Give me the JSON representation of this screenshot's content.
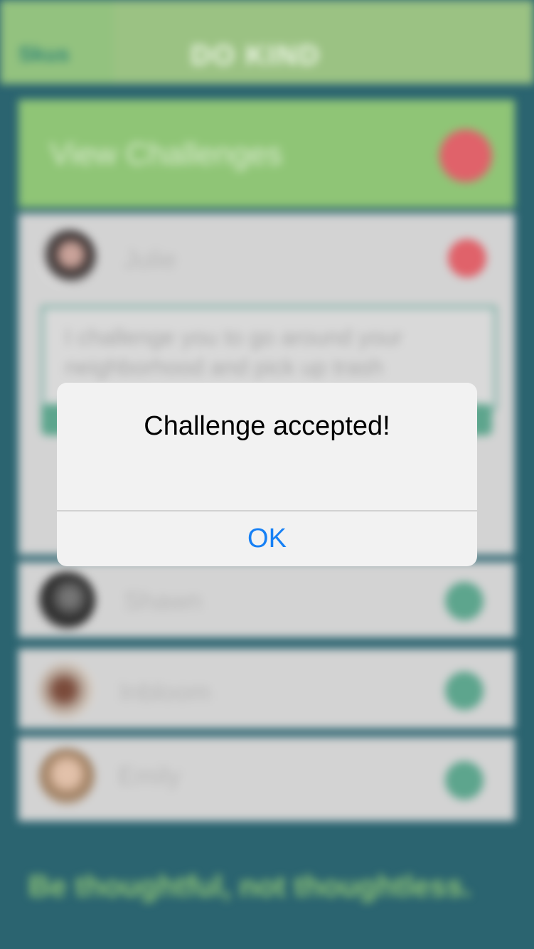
{
  "navbar": {
    "back_label": "Skus",
    "title": "DO KIND"
  },
  "challenges_header": {
    "title": "View Challenges"
  },
  "users": [
    {
      "name": "Julie"
    },
    {
      "name": "Shawn"
    },
    {
      "name": "Inbloom"
    },
    {
      "name": "Emily"
    }
  ],
  "challenge": {
    "text": "I challenge you to go around your neighborhood and pick up trash"
  },
  "footer": {
    "tagline": "Be thoughtful, not thoughtless."
  },
  "alert": {
    "title": "Challenge accepted!",
    "ok_label": "OK"
  },
  "colors": {
    "accent_blue": "#1680f5",
    "brand_green": "#8fc576",
    "teal_bg": "#2b6470",
    "alert_red": "#e0626a"
  }
}
